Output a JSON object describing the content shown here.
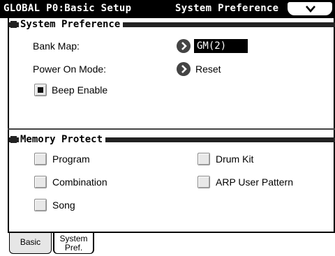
{
  "title": {
    "left": "GLOBAL P0:Basic Setup",
    "right": "System Preference"
  },
  "icons": {
    "menu": "chevron-down-icon",
    "select_arrow": "circle-arrow-right-icon"
  },
  "system_preference": {
    "header": "System Preference",
    "bank_map_label": "Bank Map:",
    "bank_map_value": "GM(2)",
    "power_on_mode_label": "Power On Mode:",
    "power_on_mode_value": "Reset",
    "beep_enable_label": "Beep Enable",
    "beep_enable_checked": true
  },
  "memory_protect": {
    "header": "Memory Protect",
    "items": [
      {
        "label": "Program",
        "checked": false
      },
      {
        "label": "Combination",
        "checked": false
      },
      {
        "label": "Song",
        "checked": false
      },
      {
        "label": "Drum Kit",
        "checked": false
      },
      {
        "label": "ARP User Pattern",
        "checked": false
      }
    ]
  },
  "tabs": {
    "basic": "Basic",
    "system_line1": "System",
    "system_line2": "Pref."
  }
}
